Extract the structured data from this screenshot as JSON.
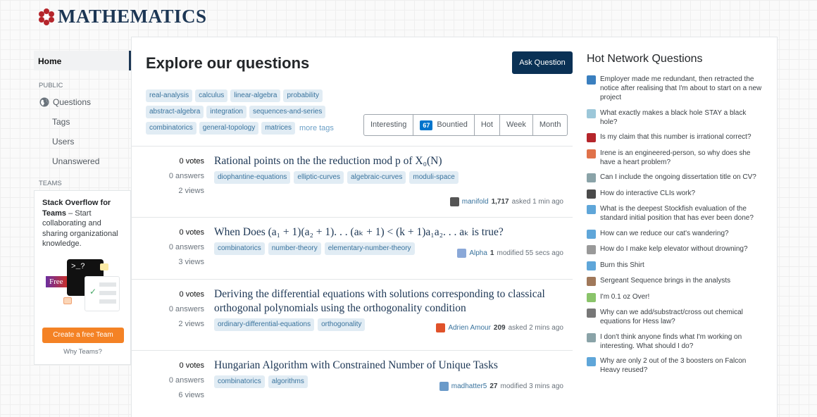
{
  "site": {
    "logo_text": "MATHEMATICS",
    "brand_color": "#1c3654",
    "logo_color": "#b5252b"
  },
  "nav": {
    "home": "Home",
    "public_label": "PUBLIC",
    "questions": "Questions",
    "tags": "Tags",
    "users": "Users",
    "unanswered": "Unanswered",
    "teams_label": "TEAMS"
  },
  "teams": {
    "title": "Stack Overflow for Teams",
    "desc": " – Start collaborating and sharing organizational knowledge.",
    "prompt": ">_?",
    "free": "Free",
    "cta": "Create a free Team",
    "why": "Why Teams?"
  },
  "main": {
    "title": "Explore our questions",
    "ask": "Ask Question",
    "tags": [
      "real-analysis",
      "calculus",
      "linear-algebra",
      "probability",
      "abstract-algebra",
      "integration",
      "sequences-and-series",
      "combinatorics",
      "general-topology",
      "matrices"
    ],
    "more_tags": "more tags",
    "filters": {
      "interesting": "Interesting",
      "bounty_count": "67",
      "bountied": "Bountied",
      "hot": "Hot",
      "week": "Week",
      "month": "Month"
    }
  },
  "questions": [
    {
      "votes": "0 votes",
      "answers": "0 answers",
      "views": "2 views",
      "title": "Rational points on the the reduction mod p of X₀(N)",
      "tags": [
        "diophantine-equations",
        "elliptic-curves",
        "algebraic-curves",
        "moduli-space"
      ],
      "user": "manifold",
      "rep": "1,717",
      "action": "asked 1 min ago"
    },
    {
      "votes": "0 votes",
      "answers": "0 answers",
      "views": "3 views",
      "title": "When Does (a₁ + 1)(a₂ + 1). . . (aₖ + 1) < (k + 1)a₁a₂. . . aₖ is true?",
      "tags": [
        "combinatorics",
        "number-theory",
        "elementary-number-theory"
      ],
      "user": "Alpha",
      "rep": "1",
      "action": "modified 55 secs ago"
    },
    {
      "votes": "0 votes",
      "answers": "0 answers",
      "views": "2 views",
      "title": "Deriving the differential equations with solutions corresponding to classical orthogonal polynomials using the orthogonality condition",
      "tags": [
        "ordinary-differential-equations",
        "orthogonality"
      ],
      "user": "Adrien Amour",
      "rep": "209",
      "action": "asked 2 mins ago"
    },
    {
      "votes": "0 votes",
      "answers": "0 answers",
      "views": "6 views",
      "title": "Hungarian Algorithm with Constrained Number of Unique Tasks",
      "tags": [
        "combinatorics",
        "algorithms"
      ],
      "user": "madhatter5",
      "rep": "27",
      "action": "modified 3 mins ago"
    }
  ],
  "hot": {
    "title": "Hot Network Questions",
    "items": [
      {
        "text": "Employer made me redundant, then retracted the notice after realising that I'm about to start on a new project",
        "icon": "workplace-icon",
        "color": "#3a7fbf"
      },
      {
        "text": "What exactly makes a black hole STAY a black hole?",
        "icon": "physics-icon",
        "color": "#9cc7d9"
      },
      {
        "text": "Is my claim that this number is irrational correct?",
        "icon": "math-icon",
        "color": "#b5252b"
      },
      {
        "text": "Irene is an engineered-person, so why does she have a heart problem?",
        "icon": "scifi-icon",
        "color": "#e0724a"
      },
      {
        "text": "Can I include the ongoing dissertation title on CV?",
        "icon": "academia-icon",
        "color": "#8aa3a8"
      },
      {
        "text": "How do interactive CLIs work?",
        "icon": "unix-icon",
        "color": "#4a4a4a"
      },
      {
        "text": "What is the deepest Stockfish evaluation of the standard initial position that has ever been done?",
        "icon": "chess-icon",
        "color": "#5fa6d9"
      },
      {
        "text": "How can we reduce our cat's wandering?",
        "icon": "pets-icon",
        "color": "#5fa6d9"
      },
      {
        "text": "How do I make kelp elevator without drowning?",
        "icon": "gaming-icon",
        "color": "#999999"
      },
      {
        "text": "Burn this Shirt",
        "icon": "puzzling-icon",
        "color": "#5fa6d9"
      },
      {
        "text": "Sergeant Sequence brings in the analysts",
        "icon": "codegolf-icon",
        "color": "#a0785a"
      },
      {
        "text": "I'm 0.1 oz Over!",
        "icon": "cooking-icon",
        "color": "#8ac46a"
      },
      {
        "text": "Why can we add/substract/cross out chemical equations for Hess law?",
        "icon": "chemistry-icon",
        "color": "#777777"
      },
      {
        "text": "I don't think anyone finds what I'm working on interesting. What should I do?",
        "icon": "academia-icon",
        "color": "#8aa3a8"
      },
      {
        "text": "Why are only 2 out of the 3 boosters on Falcon Heavy reused?",
        "icon": "space-icon",
        "color": "#5fa6d9"
      }
    ]
  }
}
